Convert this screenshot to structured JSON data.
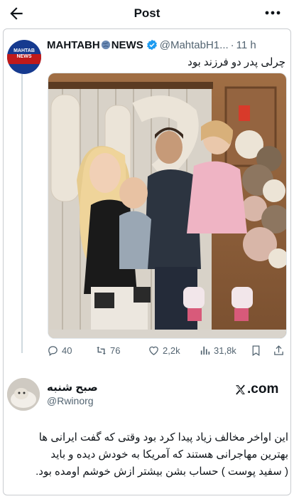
{
  "header": {
    "title": "Post",
    "back_icon": "arrow-left-icon",
    "more_icon": "more-horizontal-icon"
  },
  "tweet": {
    "avatar_text": "MAHTAB NEWS",
    "name_part1": "MAHTABH",
    "name_part2": "NEWS",
    "handle": "@MahtabH1...",
    "dot": "·",
    "time": "11 h",
    "text": "چرلی پدر دو فرزند بود",
    "actions": {
      "replies": "40",
      "retweets": "76",
      "likes": "2,2k",
      "views": "31,8k"
    }
  },
  "repost": {
    "name": "صبح شنبه",
    "handle": "@Rwinorg",
    "brand": ".com",
    "text_line1": "این اواخر مخالف زیاد پیدا کرد بود وقتی که گفت ایرانی ها",
    "text_line2": "بهترین مهاجرانی هستند که آمریکا به خودش دیده و باید",
    "text_line3": "( سفید پوست ) حساب بشن بیشتر ازش خوشم اومده بود."
  },
  "colors": {
    "text": "#0f1419",
    "muted": "#536471",
    "verified": "#1d9bf0",
    "divider": "#cfd9de"
  }
}
